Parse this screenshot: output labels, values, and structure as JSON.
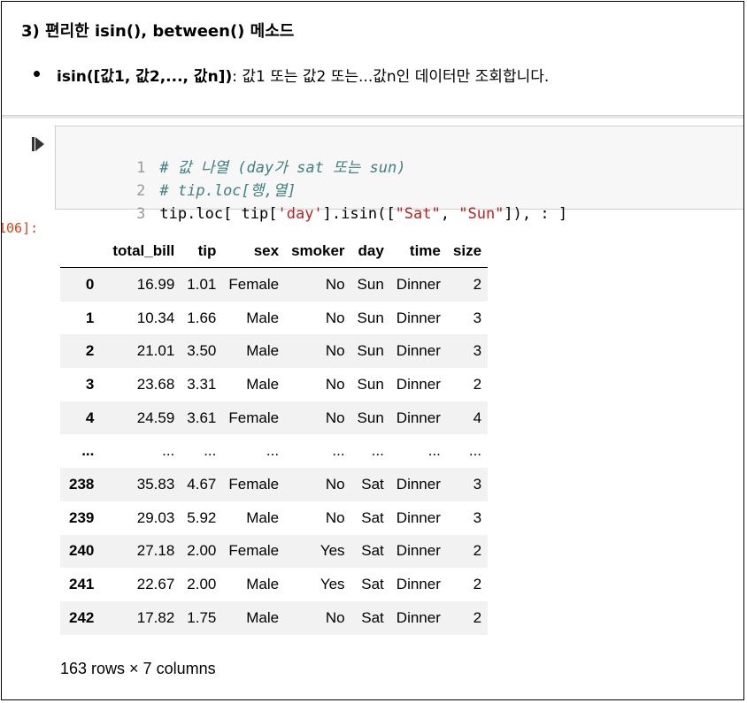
{
  "markdown": {
    "heading": "3) 편리한 isin(), between() 메소드",
    "bullet_bold": "isin([값1, 값2,..., 값n])",
    "bullet_rest": ": 값1 또는 값2 또는...값n인 데이터만 조회합니다."
  },
  "code": {
    "lines": [
      {
        "num": "1",
        "text": "# 값 나열 (day가 sat 또는 sun)"
      },
      {
        "num": "2",
        "text": "# tip.loc[행,열]"
      },
      {
        "num": "3",
        "pre": "tip.loc[ tip[",
        "s1": "'day'",
        "mid": "].isin([",
        "s2": "\"Sat\"",
        "sep": ", ",
        "s3": "\"Sun\"",
        "post": "]), : ]"
      }
    ],
    "out_prompt": "106]:"
  },
  "table": {
    "columns": [
      "",
      "total_bill",
      "tip",
      "sex",
      "smoker",
      "day",
      "time",
      "size"
    ],
    "rows": [
      [
        "0",
        "16.99",
        "1.01",
        "Female",
        "No",
        "Sun",
        "Dinner",
        "2"
      ],
      [
        "1",
        "10.34",
        "1.66",
        "Male",
        "No",
        "Sun",
        "Dinner",
        "3"
      ],
      [
        "2",
        "21.01",
        "3.50",
        "Male",
        "No",
        "Sun",
        "Dinner",
        "3"
      ],
      [
        "3",
        "23.68",
        "3.31",
        "Male",
        "No",
        "Sun",
        "Dinner",
        "2"
      ],
      [
        "4",
        "24.59",
        "3.61",
        "Female",
        "No",
        "Sun",
        "Dinner",
        "4"
      ],
      [
        "...",
        "...",
        "...",
        "...",
        "...",
        "...",
        "...",
        "..."
      ],
      [
        "238",
        "35.83",
        "4.67",
        "Female",
        "No",
        "Sat",
        "Dinner",
        "3"
      ],
      [
        "239",
        "29.03",
        "5.92",
        "Male",
        "No",
        "Sat",
        "Dinner",
        "3"
      ],
      [
        "240",
        "27.18",
        "2.00",
        "Female",
        "Yes",
        "Sat",
        "Dinner",
        "2"
      ],
      [
        "241",
        "22.67",
        "2.00",
        "Male",
        "Yes",
        "Sat",
        "Dinner",
        "2"
      ],
      [
        "242",
        "17.82",
        "1.75",
        "Male",
        "No",
        "Sat",
        "Dinner",
        "2"
      ]
    ],
    "shape": "163 rows × 7 columns"
  },
  "icons": {
    "run": "run-cell-icon"
  }
}
